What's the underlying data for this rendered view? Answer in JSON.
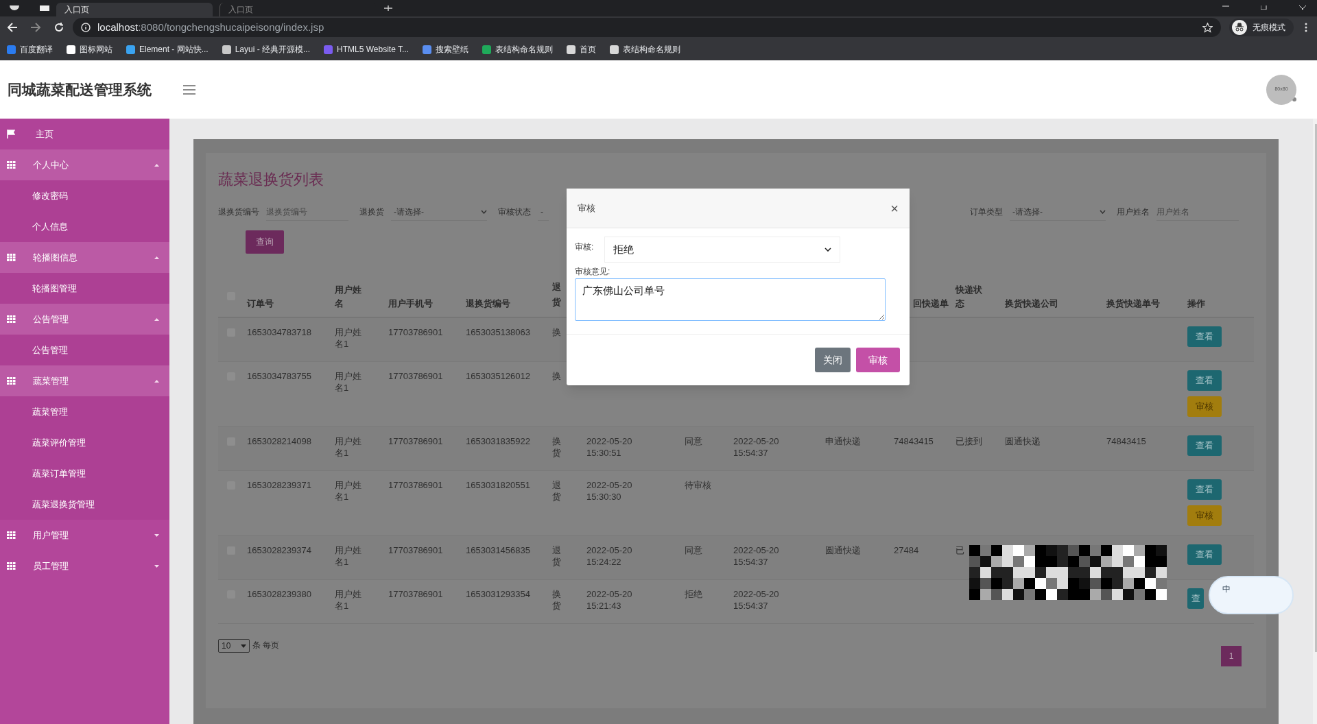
{
  "browser": {
    "tabs": [
      {
        "title": "入口页",
        "selected": true
      },
      {
        "title": "入口页",
        "selected": false
      }
    ],
    "url_host": "localhost",
    "url_rest": ":8080/tongchengshucaipeisong/index.jsp",
    "profile": "无痕模式",
    "bookmarks": [
      {
        "label": "百度翻译",
        "color": "#2b7cf0"
      },
      {
        "label": "图标网站",
        "color": "#ffffff"
      },
      {
        "label": "Element - 网站快...",
        "color": "#3aa3f0"
      },
      {
        "label": "Layui - 经典开源模...",
        "color": "#c8c8c8"
      },
      {
        "label": "HTML5 Website T...",
        "color": "#7b5cf0"
      },
      {
        "label": "搜索壁纸",
        "color": "#5a8ef0"
      },
      {
        "label": "表结构命名规则",
        "color": "#1faa5a"
      },
      {
        "label": "首页",
        "color": "#d8d8d8"
      },
      {
        "label": "表结构命名规则",
        "color": "#d8d8d8"
      }
    ]
  },
  "app": {
    "title": "同城蔬菜配送管理系统",
    "avatar": "80x80"
  },
  "sidebar": [
    {
      "label": "主页",
      "kind": "home"
    },
    {
      "label": "个人中心",
      "kind": "group",
      "expanded": true,
      "children": [
        {
          "label": "修改密码"
        },
        {
          "label": "个人信息"
        }
      ]
    },
    {
      "label": "轮播图信息",
      "kind": "group",
      "expanded": true,
      "children": [
        {
          "label": "轮播图管理"
        }
      ]
    },
    {
      "label": "公告管理",
      "kind": "group",
      "expanded": true,
      "children": [
        {
          "label": "公告管理"
        }
      ]
    },
    {
      "label": "蔬菜管理",
      "kind": "group",
      "expanded": true,
      "children": [
        {
          "label": "蔬菜管理"
        },
        {
          "label": "蔬菜评价管理"
        },
        {
          "label": "蔬菜订单管理"
        },
        {
          "label": "蔬菜退换货管理"
        }
      ]
    },
    {
      "label": "用户管理",
      "kind": "group",
      "expanded": false
    },
    {
      "label": "员工管理",
      "kind": "group",
      "expanded": false
    }
  ],
  "page": {
    "title": "蔬菜退换货列表",
    "filters": [
      {
        "label": "退换货编号",
        "kind": "input",
        "placeholder": "退换货编号"
      },
      {
        "label": "退换货",
        "kind": "select",
        "value": "-请选择-"
      },
      {
        "label": "审核状态",
        "kind": "select",
        "value": "-"
      },
      {
        "label": "订单类型",
        "kind": "select",
        "value": "-请选择-"
      },
      {
        "label": "用户姓名",
        "kind": "input",
        "placeholder": "用户姓名"
      }
    ],
    "search_button": "查询",
    "table": {
      "select_all_checked": false,
      "columns": [
        "订单号",
        "用户姓名",
        "用户手机号",
        "退换货编号",
        "退货",
        null,
        null,
        null,
        null,
        "回快递单",
        "快递状态",
        "换货快递公司",
        "换货快递单号",
        "操作"
      ],
      "rows": [
        {
          "checked": false,
          "cells": [
            "1653034783718",
            "用户姓名1",
            "17703786901",
            "1653035138063",
            "换",
            null,
            null,
            null,
            null,
            null,
            null,
            null,
            null
          ],
          "actions": [
            {
              "label": "查看",
              "kind": "view"
            }
          ]
        },
        {
          "checked": false,
          "cells": [
            "1653034783755",
            "用户姓名1",
            "17703786901",
            "1653035126012",
            "换",
            null,
            null,
            null,
            null,
            null,
            null,
            null,
            null
          ],
          "actions": [
            {
              "label": "查看",
              "kind": "view"
            },
            {
              "label": "审核",
              "kind": "audit"
            }
          ]
        },
        {
          "checked": false,
          "cells": [
            "1653028214098",
            "用户姓名1",
            "17703786901",
            "1653031835922",
            "换货",
            "2022-05-20 15:30:51",
            "同意",
            "2022-05-20 15:54:37",
            "申通快递",
            "74843415",
            "已接到",
            "圆通快递",
            "74843415"
          ],
          "actions": [
            {
              "label": "查看",
              "kind": "view"
            }
          ]
        },
        {
          "checked": false,
          "cells": [
            "1653028239371",
            "用户姓名1",
            "17703786901",
            "1653031820551",
            "退货",
            "2022-05-20 15:30:30",
            "待审核",
            null,
            null,
            null,
            null,
            null,
            null
          ],
          "actions": [
            {
              "label": "查看",
              "kind": "view"
            },
            {
              "label": "审核",
              "kind": "audit"
            }
          ]
        },
        {
          "checked": false,
          "cells": [
            "1653028239374",
            "用户姓名1",
            "17703786901",
            "1653031456835",
            "退货",
            "2022-05-20 15:24:22",
            "同意",
            "2022-05-20 15:54:37",
            "圆通快递",
            "27484",
            "已",
            null,
            null
          ],
          "actions": [
            {
              "label": "查看",
              "kind": "view"
            }
          ]
        },
        {
          "checked": false,
          "cells": [
            "1653028239380",
            "用户姓名1",
            "17703786901",
            "1653031293354",
            "换货",
            "2022-05-20 15:21:43",
            "拒绝",
            "2022-05-20 15:54:37",
            null,
            null,
            null,
            null,
            null
          ],
          "actions": [
            {
              "label": "查",
              "kind": "view",
              "clipped": true
            }
          ]
        }
      ]
    },
    "page_size": "10",
    "page_size_label": "条 每页",
    "pages": [
      {
        "label": "1",
        "selected": true
      }
    ]
  },
  "dialog": {
    "title": "审核",
    "close": "×",
    "audit_label": "审核:",
    "audit_value": "拒绝",
    "opinion_label": "审核意见:",
    "opinion_value": "广东佛山公司单号",
    "buttons": [
      {
        "label": "关闭",
        "kind": "secondary"
      },
      {
        "label": "审核",
        "kind": "primary"
      }
    ]
  },
  "ime_indicator": "中"
}
